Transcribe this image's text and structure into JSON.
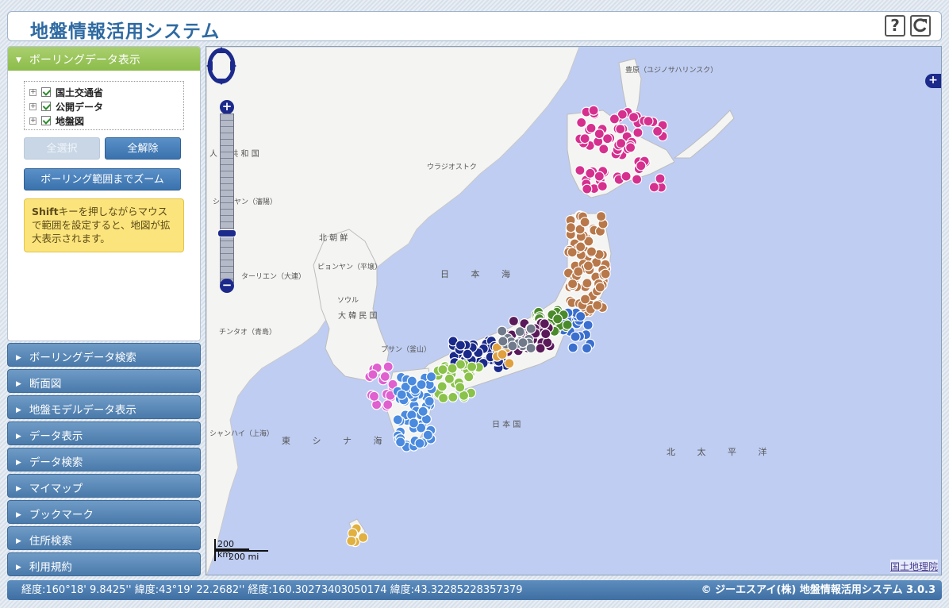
{
  "header": {
    "title": "地盤情報活用システム",
    "help_label": "?",
    "reload_label": "C"
  },
  "sidebar": {
    "active_panel": "ボーリングデータ表示",
    "tree": [
      {
        "label": "国土交通省",
        "checked": true
      },
      {
        "label": "公開データ",
        "checked": true
      },
      {
        "label": "地盤図",
        "checked": true
      }
    ],
    "select_all": "全選択",
    "deselect_all": "全解除",
    "zoom_to_range": "ボーリング範囲までズーム",
    "notice_bold": "Shift",
    "notice_text": "キーを押しながらマウスで範囲を設定すると、地図が拡大表示されます。",
    "panels": [
      "ボーリングデータ検索",
      "断面図",
      "地盤モデルデータ表示",
      "データ表示",
      "データ検索",
      "マイマップ",
      "ブックマーク",
      "住所検索",
      "利用規約"
    ]
  },
  "map": {
    "labels": {
      "toyohara": "豊原（ユジノサハリンスク）",
      "vladivostok": "ウラジオストク",
      "pyongyang": "ピョンヤン（平壌）",
      "seoul": "ソウル",
      "busan": "プサン（釜山）",
      "dalian": "ターリエン（大連）",
      "qingdao": "チンタオ（青島）",
      "shanghai": "シャンハイ（上海）",
      "shenyang": "シェンヤン（瀋陽）",
      "north_korea": "北 朝 鮮",
      "south_korea": "大 韓 民 国",
      "china": "人 民 共 和 国",
      "sea_japan": "日 本 海",
      "east_china_sea": "東 シ ナ 海",
      "pacific": "北 太 平 洋",
      "japan": "日 本 国"
    },
    "scale_km": "200 km",
    "scale_mi": "200 mi",
    "attribution": "国土地理院",
    "boring_colors": {
      "hokkaido": "#d6308f",
      "tohoku": "#b8784a",
      "kanto": "#3a6fd0",
      "chubu_north": "#4a8a2a",
      "chubu": "#5a1a5a",
      "kinki": "#1a2a8a",
      "shikoku": "#8ac24a",
      "chugoku_islands": "#e060d0",
      "kyushu": "#4a8adf",
      "okinawa": "#e0b040",
      "tokai_orange": "#e0a040",
      "gray": "#707a8a"
    }
  },
  "status": {
    "coords": "経度:160°18' 9.8425'' 緯度:43°19' 22.2682''  経度:160.30273403050174 緯度:43.32285228357379",
    "copyright": "© ジーエスアイ(株)  地盤情報活用システム 3.0.3"
  }
}
